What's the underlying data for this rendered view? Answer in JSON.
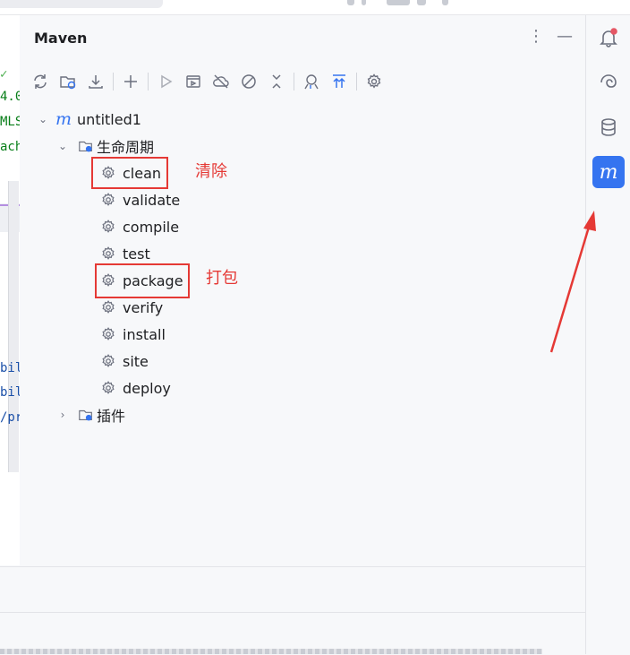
{
  "panel": {
    "title": "Maven",
    "more_icon": "more-vertical-icon",
    "minimize_icon": "minimize-icon"
  },
  "toolbar": [
    {
      "name": "reload-icon"
    },
    {
      "name": "generate-sources-icon"
    },
    {
      "name": "download-icon"
    },
    {
      "name": "add-icon"
    },
    {
      "name": "run-icon"
    },
    {
      "name": "run-config-icon"
    },
    {
      "name": "offline-icon"
    },
    {
      "name": "skip-tests-icon"
    },
    {
      "name": "collapse-icon"
    },
    {
      "name": "analyze-dependencies-icon"
    },
    {
      "name": "expand-all-icon"
    },
    {
      "name": "settings-icon"
    }
  ],
  "tree": {
    "project": "untitled1",
    "lifecycle": "生命周期",
    "goals": [
      "clean",
      "validate",
      "compile",
      "test",
      "package",
      "verify",
      "install",
      "site",
      "deploy"
    ],
    "plugins": "插件"
  },
  "annotations": {
    "clean": "清除",
    "package": "打包"
  },
  "editor_fragments": [
    {
      "text": "4.0",
      "cls": "green"
    },
    {
      "text": "MLS",
      "cls": "green"
    },
    {
      "text": "ach",
      "cls": "green"
    },
    {
      "text": "bil",
      "cls": "blue"
    },
    {
      "text": "bil",
      "cls": "blue"
    },
    {
      "text": "/pr",
      "cls": "blue"
    }
  ],
  "rightbar": [
    {
      "name": "notifications-icon"
    },
    {
      "name": "ai-assistant-icon"
    },
    {
      "name": "database-icon"
    },
    {
      "name": "maven-icon",
      "active": true
    }
  ],
  "colors": {
    "accent": "#3574f0",
    "annotation": "#e53935",
    "notification_dot": "#e55765"
  }
}
